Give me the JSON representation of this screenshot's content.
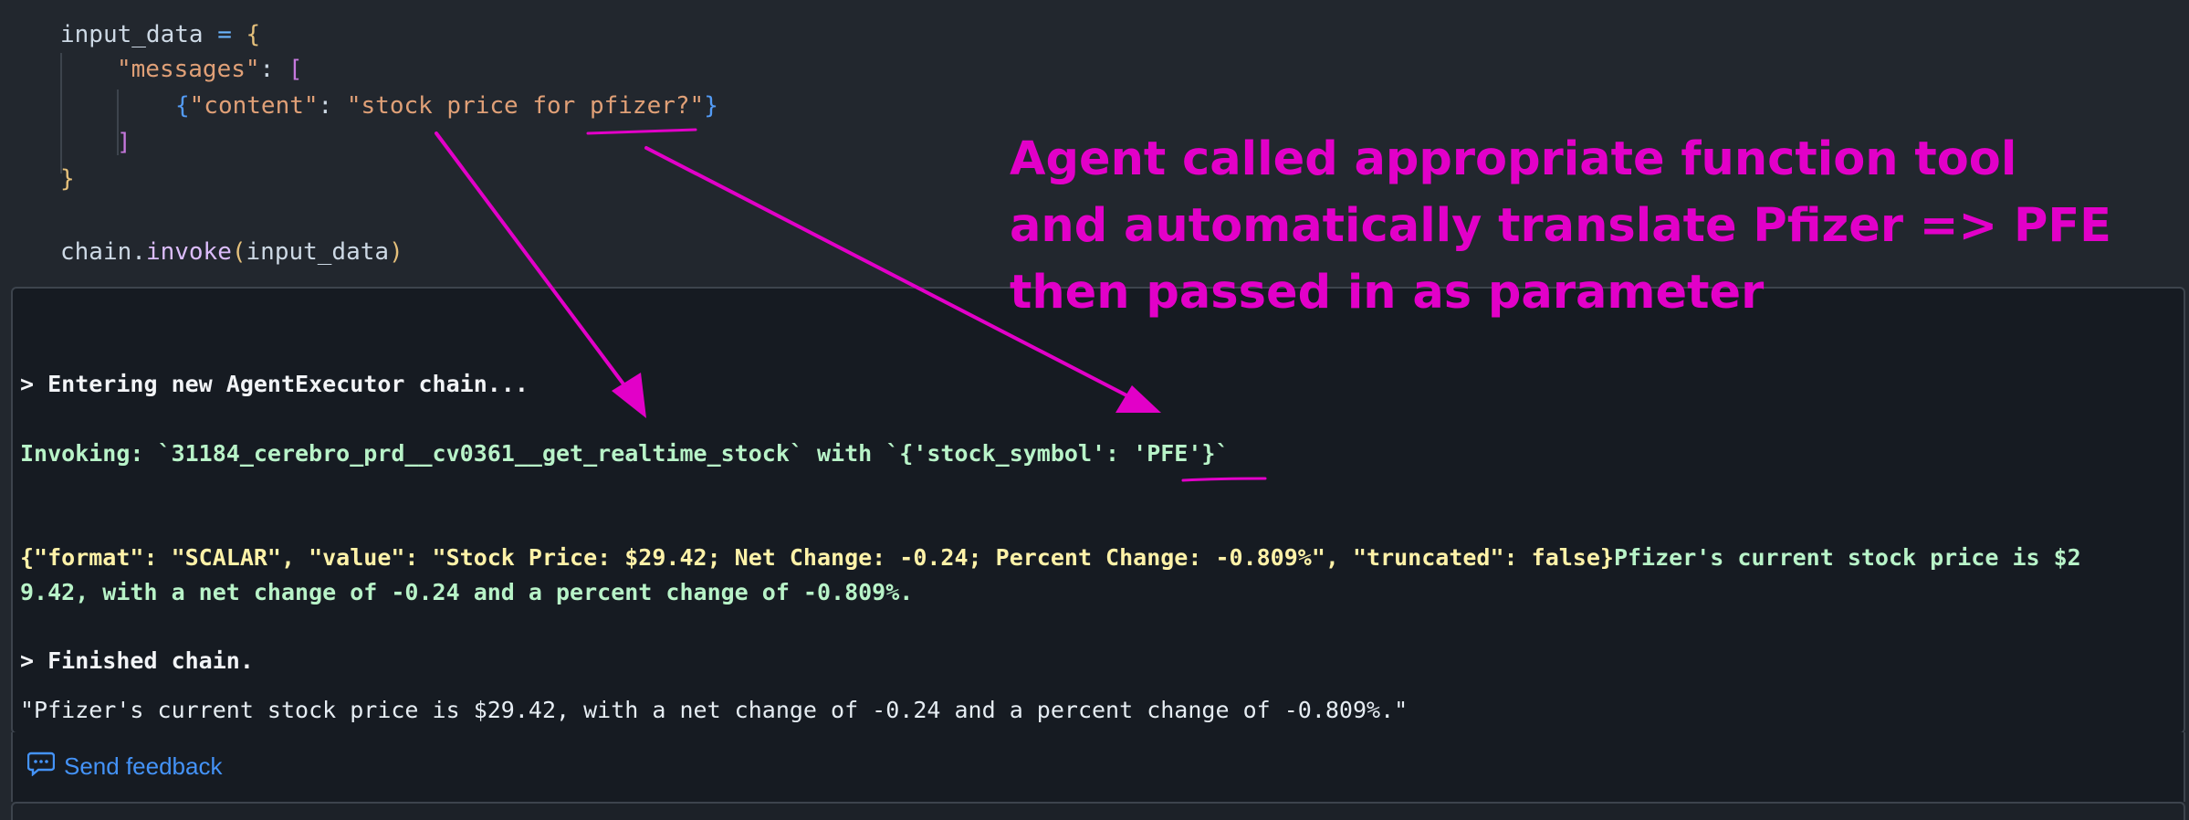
{
  "code": {
    "line1": {
      "var": "input_data",
      "op": " = ",
      "brace": "{"
    },
    "line2": {
      "key": "\"messages\"",
      "colon": ": ",
      "bracket": "["
    },
    "line3": {
      "open": "{",
      "key": "\"content\"",
      "colon": ": ",
      "value": "\"stock price for pfizer?\"",
      "close": "}"
    },
    "line4": {
      "bracket": "]"
    },
    "line5": {
      "brace": "}"
    },
    "line7": {
      "obj": "chain",
      "dot": ".",
      "fn": "invoke",
      "open": "(",
      "arg": "input_data",
      "close": ")"
    }
  },
  "output": {
    "entering": "> Entering new AgentExecutor chain...",
    "invoking": "Invoking: `31184_cerebro_prd__cv0361__get_realtime_stock` with `{'stock_symbol': 'PFE'}`",
    "result_part1": "{\"format\": \"SCALAR\", \"value\": \"Stock Price: $29.42; Net Change: -0.24; Percent Change: -0.809%\", \"truncated\": false}",
    "result_part2": "Pfizer's current stock price is $2",
    "result_line2": "9.42, with a net change of -0.24 and a percent change of -0.809%.",
    "finished": "> Finished chain.",
    "final": "\"Pfizer's current stock price is $29.42, with a net change of -0.24 and a percent change of -0.809%.\""
  },
  "feedback": {
    "label": "Send feedback",
    "icon": "chat-bubble-icon",
    "link_color": "#4493f8"
  },
  "annotation": {
    "line1": "Agent called appropriate function tool",
    "line2": "and automatically translate Pfizer => PFE",
    "line3": "then passed in as parameter",
    "color": "#e200c8"
  }
}
